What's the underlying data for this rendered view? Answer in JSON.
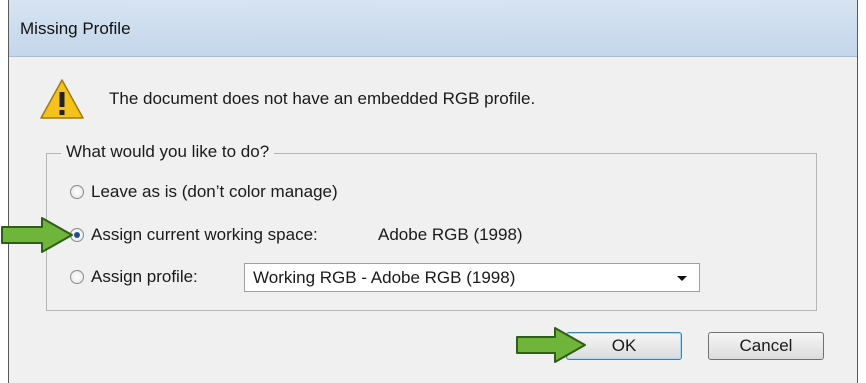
{
  "dialog": {
    "title": "Missing Profile",
    "message": "The document does not have an embedded RGB profile.",
    "group_label": "What would you like to do?",
    "options": [
      {
        "label": "Leave as is (don’t color manage)",
        "checked": false
      },
      {
        "label": "Assign current working space:",
        "checked": true
      },
      {
        "label": "Assign profile:",
        "checked": false
      }
    ],
    "working_space_value": "Adobe RGB (1998)",
    "profile_select_value": "Working RGB - Adobe RGB (1998)",
    "ok_label": "OK",
    "cancel_label": "Cancel"
  },
  "icons": {
    "warning": "warning-icon",
    "pointer_arrows": "green-arrow-icon"
  },
  "colors": {
    "arrow_green": "#6fb53c",
    "warning_yellow": "#f4c21b"
  }
}
